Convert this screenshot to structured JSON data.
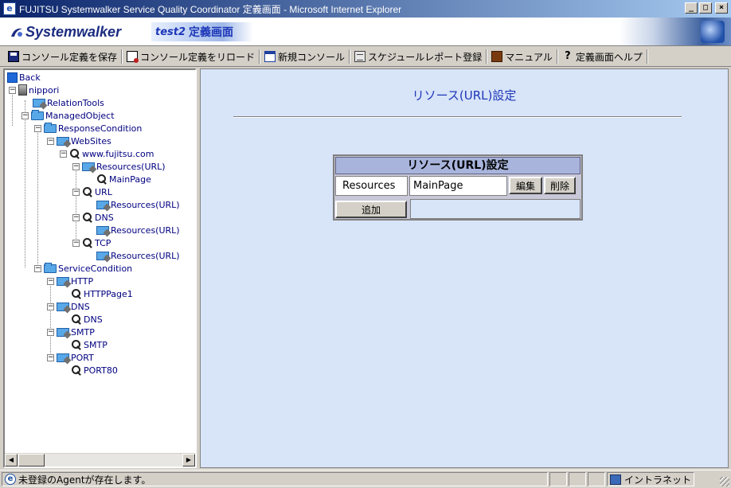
{
  "window": {
    "title": "FUJITSU Systemwalker Service Quality Coordinator 定義画面 - Microsoft Internet Explorer",
    "icon_glyph": "e",
    "buttons": {
      "minimize": "_",
      "maximize": "□",
      "close": "×"
    }
  },
  "banner": {
    "logo_text": "Systemwalker",
    "page_prefix": "test2",
    "page_title": "定義画面"
  },
  "toolbar": {
    "items": [
      {
        "label": "コンソール定義を保存",
        "icon": "save-icon"
      },
      {
        "label": "コンソール定義をリロード",
        "icon": "reload-icon"
      },
      {
        "label": "新規コンソール",
        "icon": "console-icon"
      },
      {
        "label": "スケジュールレポート登録",
        "icon": "report-icon"
      },
      {
        "label": "マニュアル",
        "icon": "manual-icon"
      },
      {
        "label": "定義画面ヘルプ",
        "icon": "help-icon",
        "glyph": "?"
      }
    ]
  },
  "tree": {
    "nodes": [
      {
        "label": "Back",
        "icon": "back-icon",
        "expander": ""
      },
      {
        "label": "nippori",
        "icon": "server-icon",
        "expander": "−"
      },
      {
        "label": "RelationTools",
        "icon": "tool-folder-icon",
        "expander": ""
      },
      {
        "label": "ManagedObject",
        "icon": "folder-icon",
        "expander": "−"
      },
      {
        "label": "ResponseCondition",
        "icon": "folder-icon",
        "expander": "−"
      },
      {
        "label": "WebSites",
        "icon": "tool-folder-icon",
        "expander": "−"
      },
      {
        "label": "www.fujitsu.com",
        "icon": "search-icon",
        "expander": "−"
      },
      {
        "label": "Resources(URL)",
        "icon": "tool-folder-icon",
        "expander": "−"
      },
      {
        "label": "MainPage",
        "icon": "search-icon",
        "expander": ""
      },
      {
        "label": "URL",
        "icon": "search-icon",
        "expander": "−"
      },
      {
        "label": "Resources(URL)",
        "icon": "tool-folder-icon",
        "expander": ""
      },
      {
        "label": "DNS",
        "icon": "search-icon",
        "expander": "−"
      },
      {
        "label": "Resources(URL)",
        "icon": "tool-folder-icon",
        "expander": ""
      },
      {
        "label": "TCP",
        "icon": "search-icon",
        "expander": "−"
      },
      {
        "label": "Resources(URL)",
        "icon": "tool-folder-icon",
        "expander": ""
      },
      {
        "label": "ServiceCondition",
        "icon": "folder-icon",
        "expander": "−"
      },
      {
        "label": "HTTP",
        "icon": "tool-folder-icon",
        "expander": "−"
      },
      {
        "label": "HTTPPage1",
        "icon": "search-icon",
        "expander": ""
      },
      {
        "label": "DNS",
        "icon": "tool-folder-icon",
        "expander": "−"
      },
      {
        "label": "DNS",
        "icon": "search-icon",
        "expander": ""
      },
      {
        "label": "SMTP",
        "icon": "tool-folder-icon",
        "expander": "−"
      },
      {
        "label": "SMTP",
        "icon": "search-icon",
        "expander": ""
      },
      {
        "label": "PORT",
        "icon": "tool-folder-icon",
        "expander": "−"
      },
      {
        "label": "PORT80",
        "icon": "search-icon",
        "expander": ""
      }
    ]
  },
  "main": {
    "title": "リソース(URL)設定",
    "table": {
      "header": "リソース(URL)設定",
      "row_label": "Resources",
      "row_value": "MainPage",
      "edit_label": "編集",
      "delete_label": "削除",
      "add_label": "追加"
    }
  },
  "statusbar": {
    "message": "未登録のAgentが存在します。",
    "zone": "イントラネット"
  },
  "colors": {
    "title_gradient_start": "#0a246a",
    "content_bg": "#d8e4f8",
    "tree_text": "#000080",
    "heading_text": "#1c36b8"
  }
}
